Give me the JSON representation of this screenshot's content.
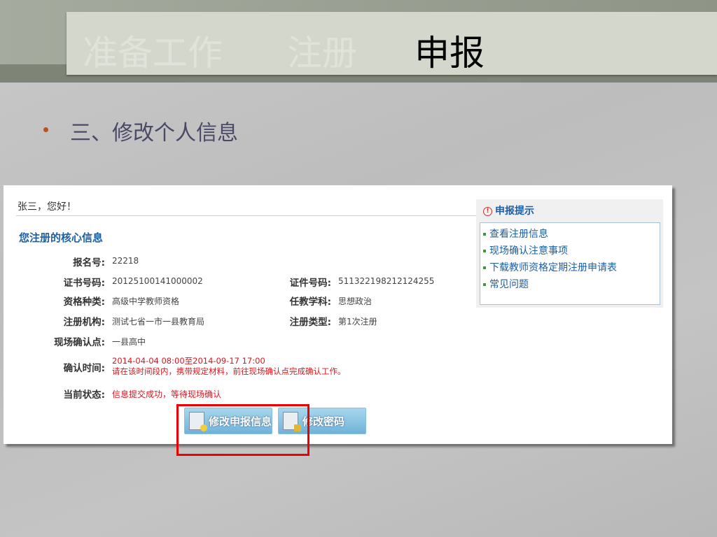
{
  "slide": {
    "nav": [
      "准备工作",
      "注册",
      "申报"
    ],
    "active_nav": "申报",
    "subheading": "三、修改个人信息"
  },
  "panel": {
    "greeting": "张三，您好！",
    "section_title": "您注册的核心信息",
    "fields": {
      "reg_no": {
        "label": "报名号:",
        "value": "22218"
      },
      "cert_no": {
        "label": "证书号码:",
        "value": "20125100141000002"
      },
      "id_no": {
        "label": "证件号码:",
        "value": "511322198212124255"
      },
      "qual_type": {
        "label": "资格种类:",
        "value": "高级中学教师资格"
      },
      "subject": {
        "label": "任教学科:",
        "value": "思想政治"
      },
      "org": {
        "label": "注册机构:",
        "value": "测试七省一市一县教育局"
      },
      "reg_type": {
        "label": "注册类型:",
        "value": "第1次注册"
      },
      "site": {
        "label": "现场确认点:",
        "value": "一县高中"
      },
      "confirm_time": {
        "label": "确认时间:",
        "value": "2014-04-04 08:00至2014-09-17 17:00",
        "note": "请在该时间段内，携带规定材料，前往现场确认点完成确认工作。"
      },
      "status": {
        "label": "当前状态:",
        "value": "信息提交成功，等待现场确认"
      }
    },
    "buttons": {
      "edit_info": "修改申报信息",
      "edit_password": "修改密码"
    },
    "tips": {
      "title": "申报提示",
      "items": [
        "查看注册信息",
        "现场确认注意事项",
        "下载教师资格定期注册申请表",
        "常见问题"
      ]
    }
  }
}
